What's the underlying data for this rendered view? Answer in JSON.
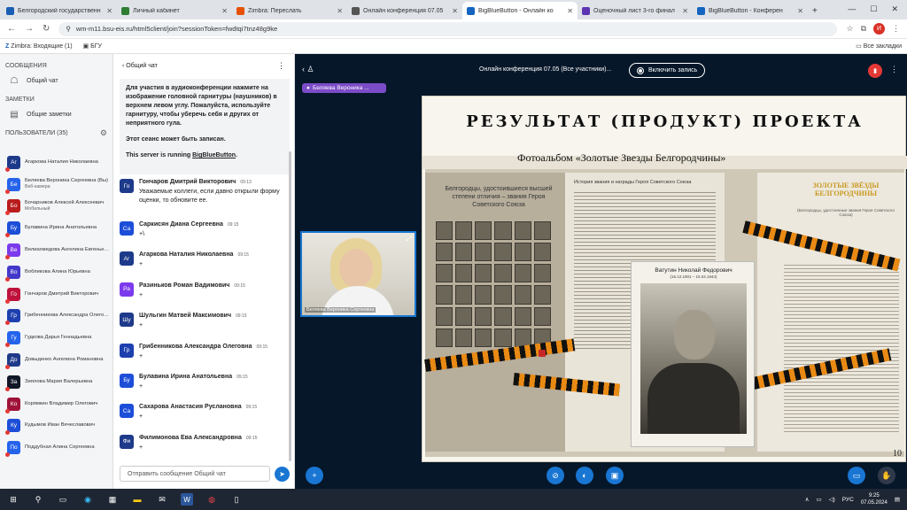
{
  "browser": {
    "tabs": [
      {
        "title": "Белгородский государственн",
        "color": "#1a5fb4",
        "active": false
      },
      {
        "title": "Личный кабинет",
        "color": "#2e7d32",
        "active": false
      },
      {
        "title": "Zimbra: Переслать",
        "color": "#e65100",
        "active": false
      },
      {
        "title": "Онлайн конференция 07.05",
        "color": "#555555",
        "active": false
      },
      {
        "title": "BigBlueButton - Онлайн ко",
        "color": "#1565c0",
        "active": true
      },
      {
        "title": "Оценочный лист 3-го финал",
        "color": "#5e35b1",
        "active": false
      },
      {
        "title": "BigBlueButton - Конферен",
        "color": "#1565c0",
        "active": false
      }
    ],
    "new_tab": "+",
    "url": "wm-m11.bsu-eis.ru/html5client/join?sessionToken=fwdtqi7tnz48g9ke",
    "profile_initial": "И",
    "bookmarks": [
      "Zimbra: Входящие (1)",
      "БГУ"
    ],
    "all_bookmarks": "Все закладки"
  },
  "sidebar": {
    "messages_header": "СООБЩЕНИЯ",
    "public_chat": "Общий чат",
    "notes_header": "ЗАМЕТКИ",
    "shared_notes": "Общие заметки",
    "users_header": "ПОЛЬЗОВАТЕЛИ (35)",
    "users": [
      {
        "initials": "Аг",
        "name": "Агаркова Наталия Николаевна",
        "sub": "",
        "color": "#1e3a8a"
      },
      {
        "initials": "Бе",
        "name": "Беляева Вероника Сергеевна (Вы)",
        "sub": "Веб-камера",
        "color": "#2563eb"
      },
      {
        "initials": "Бо",
        "name": "Бочарников Алексей Алексеевич",
        "sub": "Мобильный",
        "color": "#b91c1c"
      },
      {
        "initials": "Бу",
        "name": "Булавина Ирина Анатольевна",
        "sub": "",
        "color": "#1d4ed8"
      },
      {
        "initials": "Ве",
        "name": "Велиахмедова Ангелина Евгеньевна",
        "sub": "",
        "color": "#7c3aed"
      },
      {
        "initials": "Во",
        "name": "Вобликова Алина Юрьевна",
        "sub": "",
        "color": "#4338ca"
      },
      {
        "initials": "Го",
        "name": "Гончаров Дмитрий Викторович",
        "sub": "",
        "color": "#be123c"
      },
      {
        "initials": "Гр",
        "name": "Грибенникова Александра Олеговна",
        "sub": "",
        "color": "#1e40af"
      },
      {
        "initials": "Гу",
        "name": "Гудкова Дарья Геннадьевна",
        "sub": "",
        "color": "#2563eb"
      },
      {
        "initials": "До",
        "name": "Довыденко Ангелина Романовна",
        "sub": "",
        "color": "#1e3a8a"
      },
      {
        "initials": "За",
        "name": "Зиялова Мария Валерьевна",
        "sub": "",
        "color": "#111827"
      },
      {
        "initials": "Ко",
        "name": "Корямкин Владимир Олегович",
        "sub": "",
        "color": "#9f1239"
      },
      {
        "initials": "Ку",
        "name": "Кудымов Иван Вячеславович",
        "sub": "",
        "color": "#1d4ed8"
      },
      {
        "initials": "По",
        "name": "Поддубная Алина Сергеевна",
        "sub": "",
        "color": "#2563eb"
      }
    ]
  },
  "chat": {
    "back_label": "Общий чат",
    "welcome_1": "Для участия в аудиоконференции нажмите на изображение головной гарнитуры (наушников) в верхнем левом углу.",
    "welcome_1b": "Пожалуйста, используйте гарнитуру, чтобы уберечь себя и других от неприятного гула.",
    "welcome_2": "Этот сеанс может быть записан.",
    "welcome_3": "This server is running",
    "welcome_3_link": "BigBlueButton",
    "welcome_3_end": ".",
    "messages": [
      {
        "initials": "Го",
        "name": "Гончаров Дмитрий Викторович",
        "time": "09:13",
        "text": "Уважаемые коллеги, если давно открыли форму оценки, то обновите ее.",
        "color": "#1e3a8a"
      },
      {
        "initials": "Са",
        "name": "Саркисян Диана Сергеевна",
        "time": "09:15",
        "text": "+\\",
        "color": "#1d4ed8"
      },
      {
        "initials": "Аг",
        "name": "Агаркова Наталия Николаевна",
        "time": "09:15",
        "text": "+",
        "color": "#1e3a8a"
      },
      {
        "initials": "Ра",
        "name": "Разиньков Роман Вадимович",
        "time": "09:15",
        "text": "+",
        "color": "#7c3aed"
      },
      {
        "initials": "Шу",
        "name": "Шульгин Матвей Максимович",
        "time": "09:15",
        "text": "+",
        "color": "#1e3a8a"
      },
      {
        "initials": "Гр",
        "name": "Грибенникова Александра Олеговна",
        "time": "09:15",
        "text": "+",
        "color": "#1e40af"
      },
      {
        "initials": "Бу",
        "name": "Булавина Ирина Анатольевна",
        "time": "09:15",
        "text": "+",
        "color": "#1d4ed8"
      },
      {
        "initials": "Са",
        "name": "Сахарова Анастасия Руслановна",
        "time": "09:15",
        "text": "+",
        "color": "#1d4ed8"
      },
      {
        "initials": "Фи",
        "name": "Филимонова Ева Александровна",
        "time": "09:15",
        "text": "+",
        "color": "#1e3a8a"
      }
    ],
    "input_placeholder": "Отправить сообщение Общий чат"
  },
  "meeting": {
    "title": "Онлайн конференция 07.05 (Все участники)...",
    "record_label": "Включить запись",
    "talker": "Беляева Вероника ...",
    "video_label": "Беляева Вероника Сергеевна",
    "slide": {
      "heading": "РЕЗУЛЬТАТ (ПРОДУКТ) ПРОЕКТА",
      "subheading": "Фотоальбом «Золотые Звезды Белгородчины»",
      "page1_title": "Белгородцы, удостоившиеся высшей степени отличия – звания Героя Советского Союза",
      "page2_title": "История звания и награды Героя Советского Союза",
      "hero_name": "Ватутин Николай Федорович",
      "hero_dates": "(16.12.1901 – 15.04.1944)",
      "page3_title": "ЗОЛОТЫЕ ЗВЁЗДЫ БЕЛГОРОДЧИНЫ",
      "page3_sub": "(Белгородцы, удостоенные звания Героя Советского Союза)",
      "page_number": "10"
    }
  },
  "taskbar": {
    "lang": "РУС",
    "time": "9:25",
    "date": "07.05.2024"
  }
}
